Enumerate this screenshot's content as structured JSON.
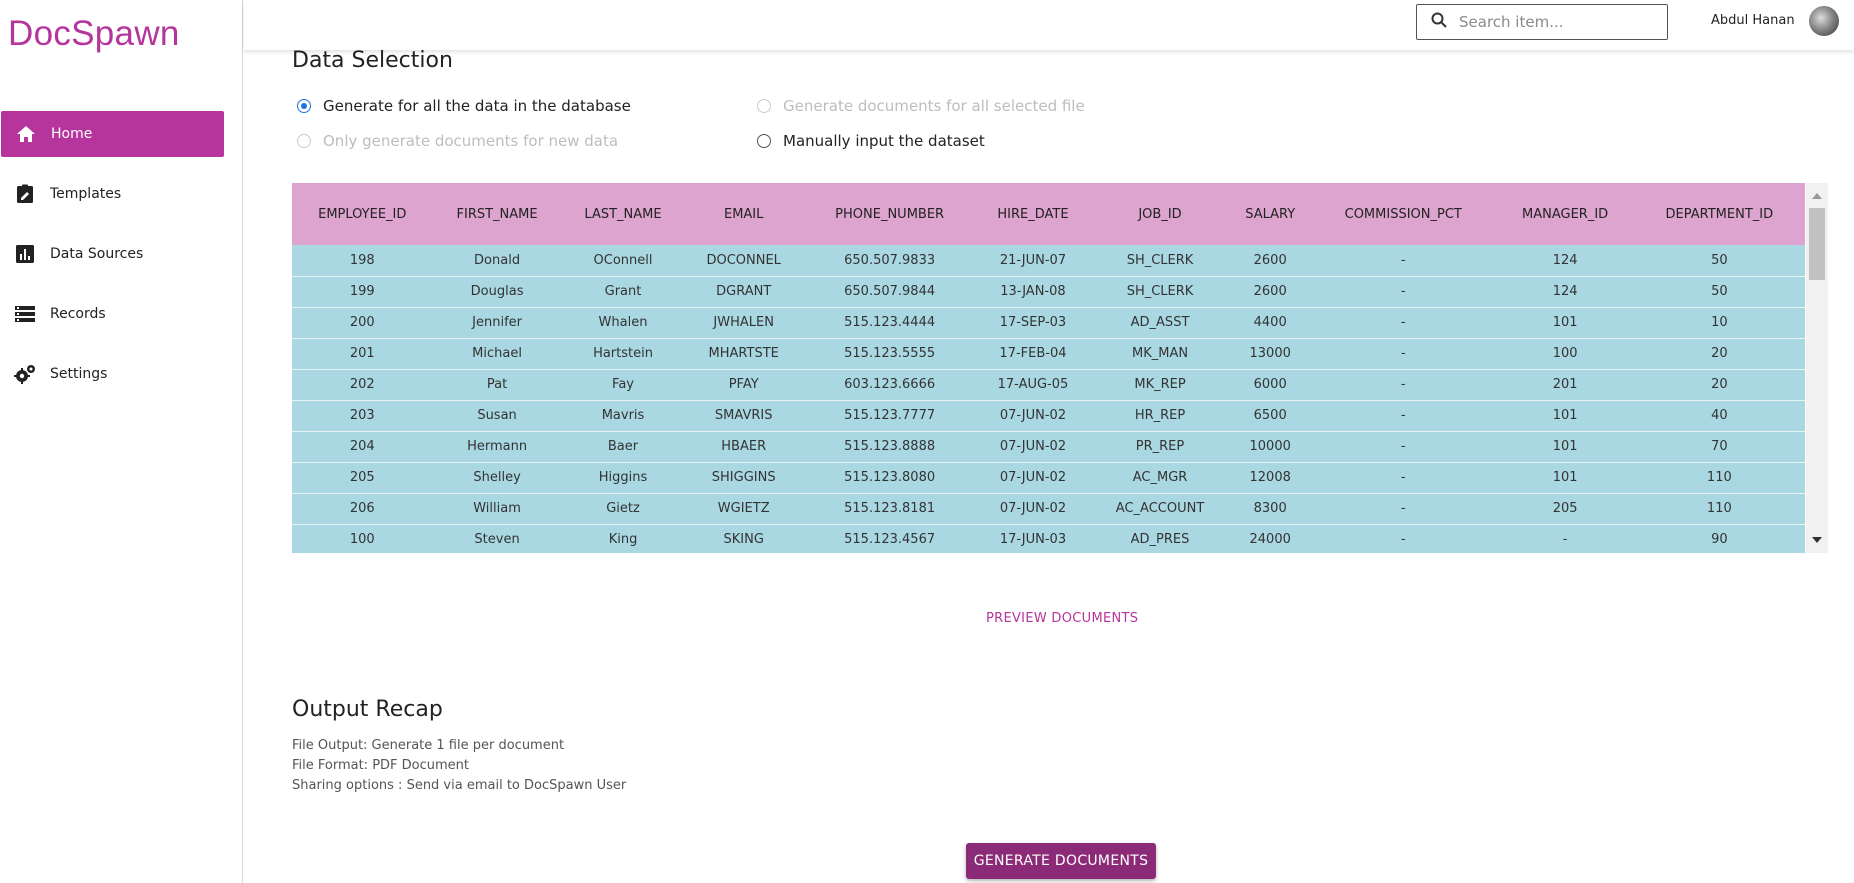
{
  "brand": "DocSpawn",
  "colors": {
    "accent": "#b5359c",
    "header_pink": "#dca4cf",
    "row_blue": "#a9d8e2",
    "button_dark": "#8b2a77"
  },
  "sidebar": {
    "items": [
      {
        "label": "Home",
        "icon": "home-icon",
        "active": true
      },
      {
        "label": "Templates",
        "icon": "clipboard-edit-icon"
      },
      {
        "label": "Data Sources",
        "icon": "bar-chart-icon"
      },
      {
        "label": "Records",
        "icon": "list-icon"
      },
      {
        "label": "Settings",
        "icon": "gears-icon"
      }
    ]
  },
  "topbar": {
    "search_placeholder": "Search item...",
    "user_name": "Abdul Hanan"
  },
  "data_selection": {
    "title": "Data Selection",
    "options": [
      {
        "label": "Generate for all the data in the database",
        "checked": true,
        "disabled": false
      },
      {
        "label": "Generate documents for all selected file",
        "checked": false,
        "disabled": true
      },
      {
        "label": "Only generate documents for new data",
        "checked": false,
        "disabled": true
      },
      {
        "label": "Manually input the dataset",
        "checked": false,
        "disabled": false
      }
    ]
  },
  "table": {
    "columns": [
      "EMPLOYEE_ID",
      "FIRST_NAME",
      "LAST_NAME",
      "EMAIL",
      "PHONE_NUMBER",
      "HIRE_DATE",
      "JOB_ID",
      "SALARY",
      "COMMISSION_PCT",
      "MANAGER_ID",
      "DEPARTMENT_ID"
    ],
    "rows": [
      [
        "198",
        "Donald",
        "OConnell",
        "DOCONNEL",
        "650.507.9833",
        "21-JUN-07",
        "SH_CLERK",
        "2600",
        "-",
        "124",
        "50"
      ],
      [
        "199",
        "Douglas",
        "Grant",
        "DGRANT",
        "650.507.9844",
        "13-JAN-08",
        "SH_CLERK",
        "2600",
        "-",
        "124",
        "50"
      ],
      [
        "200",
        "Jennifer",
        "Whalen",
        "JWHALEN",
        "515.123.4444",
        "17-SEP-03",
        "AD_ASST",
        "4400",
        "-",
        "101",
        "10"
      ],
      [
        "201",
        "Michael",
        "Hartstein",
        "MHARTSTE",
        "515.123.5555",
        "17-FEB-04",
        "MK_MAN",
        "13000",
        "-",
        "100",
        "20"
      ],
      [
        "202",
        "Pat",
        "Fay",
        "PFAY",
        "603.123.6666",
        "17-AUG-05",
        "MK_REP",
        "6000",
        "-",
        "201",
        "20"
      ],
      [
        "203",
        "Susan",
        "Mavris",
        "SMAVRIS",
        "515.123.7777",
        "07-JUN-02",
        "HR_REP",
        "6500",
        "-",
        "101",
        "40"
      ],
      [
        "204",
        "Hermann",
        "Baer",
        "HBAER",
        "515.123.8888",
        "07-JUN-02",
        "PR_REP",
        "10000",
        "-",
        "101",
        "70"
      ],
      [
        "205",
        "Shelley",
        "Higgins",
        "SHIGGINS",
        "515.123.8080",
        "07-JUN-02",
        "AC_MGR",
        "12008",
        "-",
        "101",
        "110"
      ],
      [
        "206",
        "William",
        "Gietz",
        "WGIETZ",
        "515.123.8181",
        "07-JUN-02",
        "AC_ACCOUNT",
        "8300",
        "-",
        "205",
        "110"
      ],
      [
        "100",
        "Steven",
        "King",
        "SKING",
        "515.123.4567",
        "17-JUN-03",
        "AD_PRES",
        "24000",
        "-",
        "-",
        "90"
      ]
    ]
  },
  "preview_label": "PREVIEW DOCUMENTS",
  "recap": {
    "title": "Output Recap",
    "lines": [
      "File Output: Generate 1 file per document",
      "File Format: PDF Document",
      "Sharing options : Send via email to DocSpawn User"
    ]
  },
  "generate_label": "GENERATE DOCUMENTS"
}
